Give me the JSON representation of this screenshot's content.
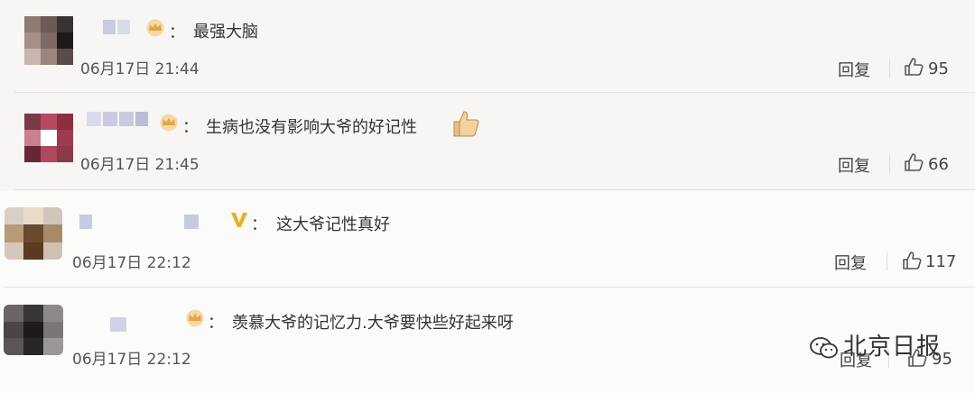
{
  "comments": [
    {
      "text": "最强大脑",
      "time": "06月17日 21:44",
      "reply_label": "回复",
      "likes": "95",
      "badge": "crown-icon"
    },
    {
      "text": "生病也没有影响大爷的好记性",
      "time": "06月17日 21:45",
      "reply_label": "回复",
      "likes": "66",
      "badge": "crown-icon"
    },
    {
      "text": "这大爷记性真好",
      "time": "06月17日 22:12",
      "reply_label": "回复",
      "likes": "117",
      "badge": "verified-v-icon"
    },
    {
      "text": "羡慕大爷的记忆力.大爷要快些好起来呀",
      "time": "06月17日 22:12",
      "reply_label": "回复",
      "likes": "95",
      "badge": "crown-icon"
    }
  ],
  "watermark": "北京日报",
  "colors": {
    "crown": "#e0a64a",
    "verified": "#e8b020",
    "username_blur": "#c8cbe0"
  }
}
